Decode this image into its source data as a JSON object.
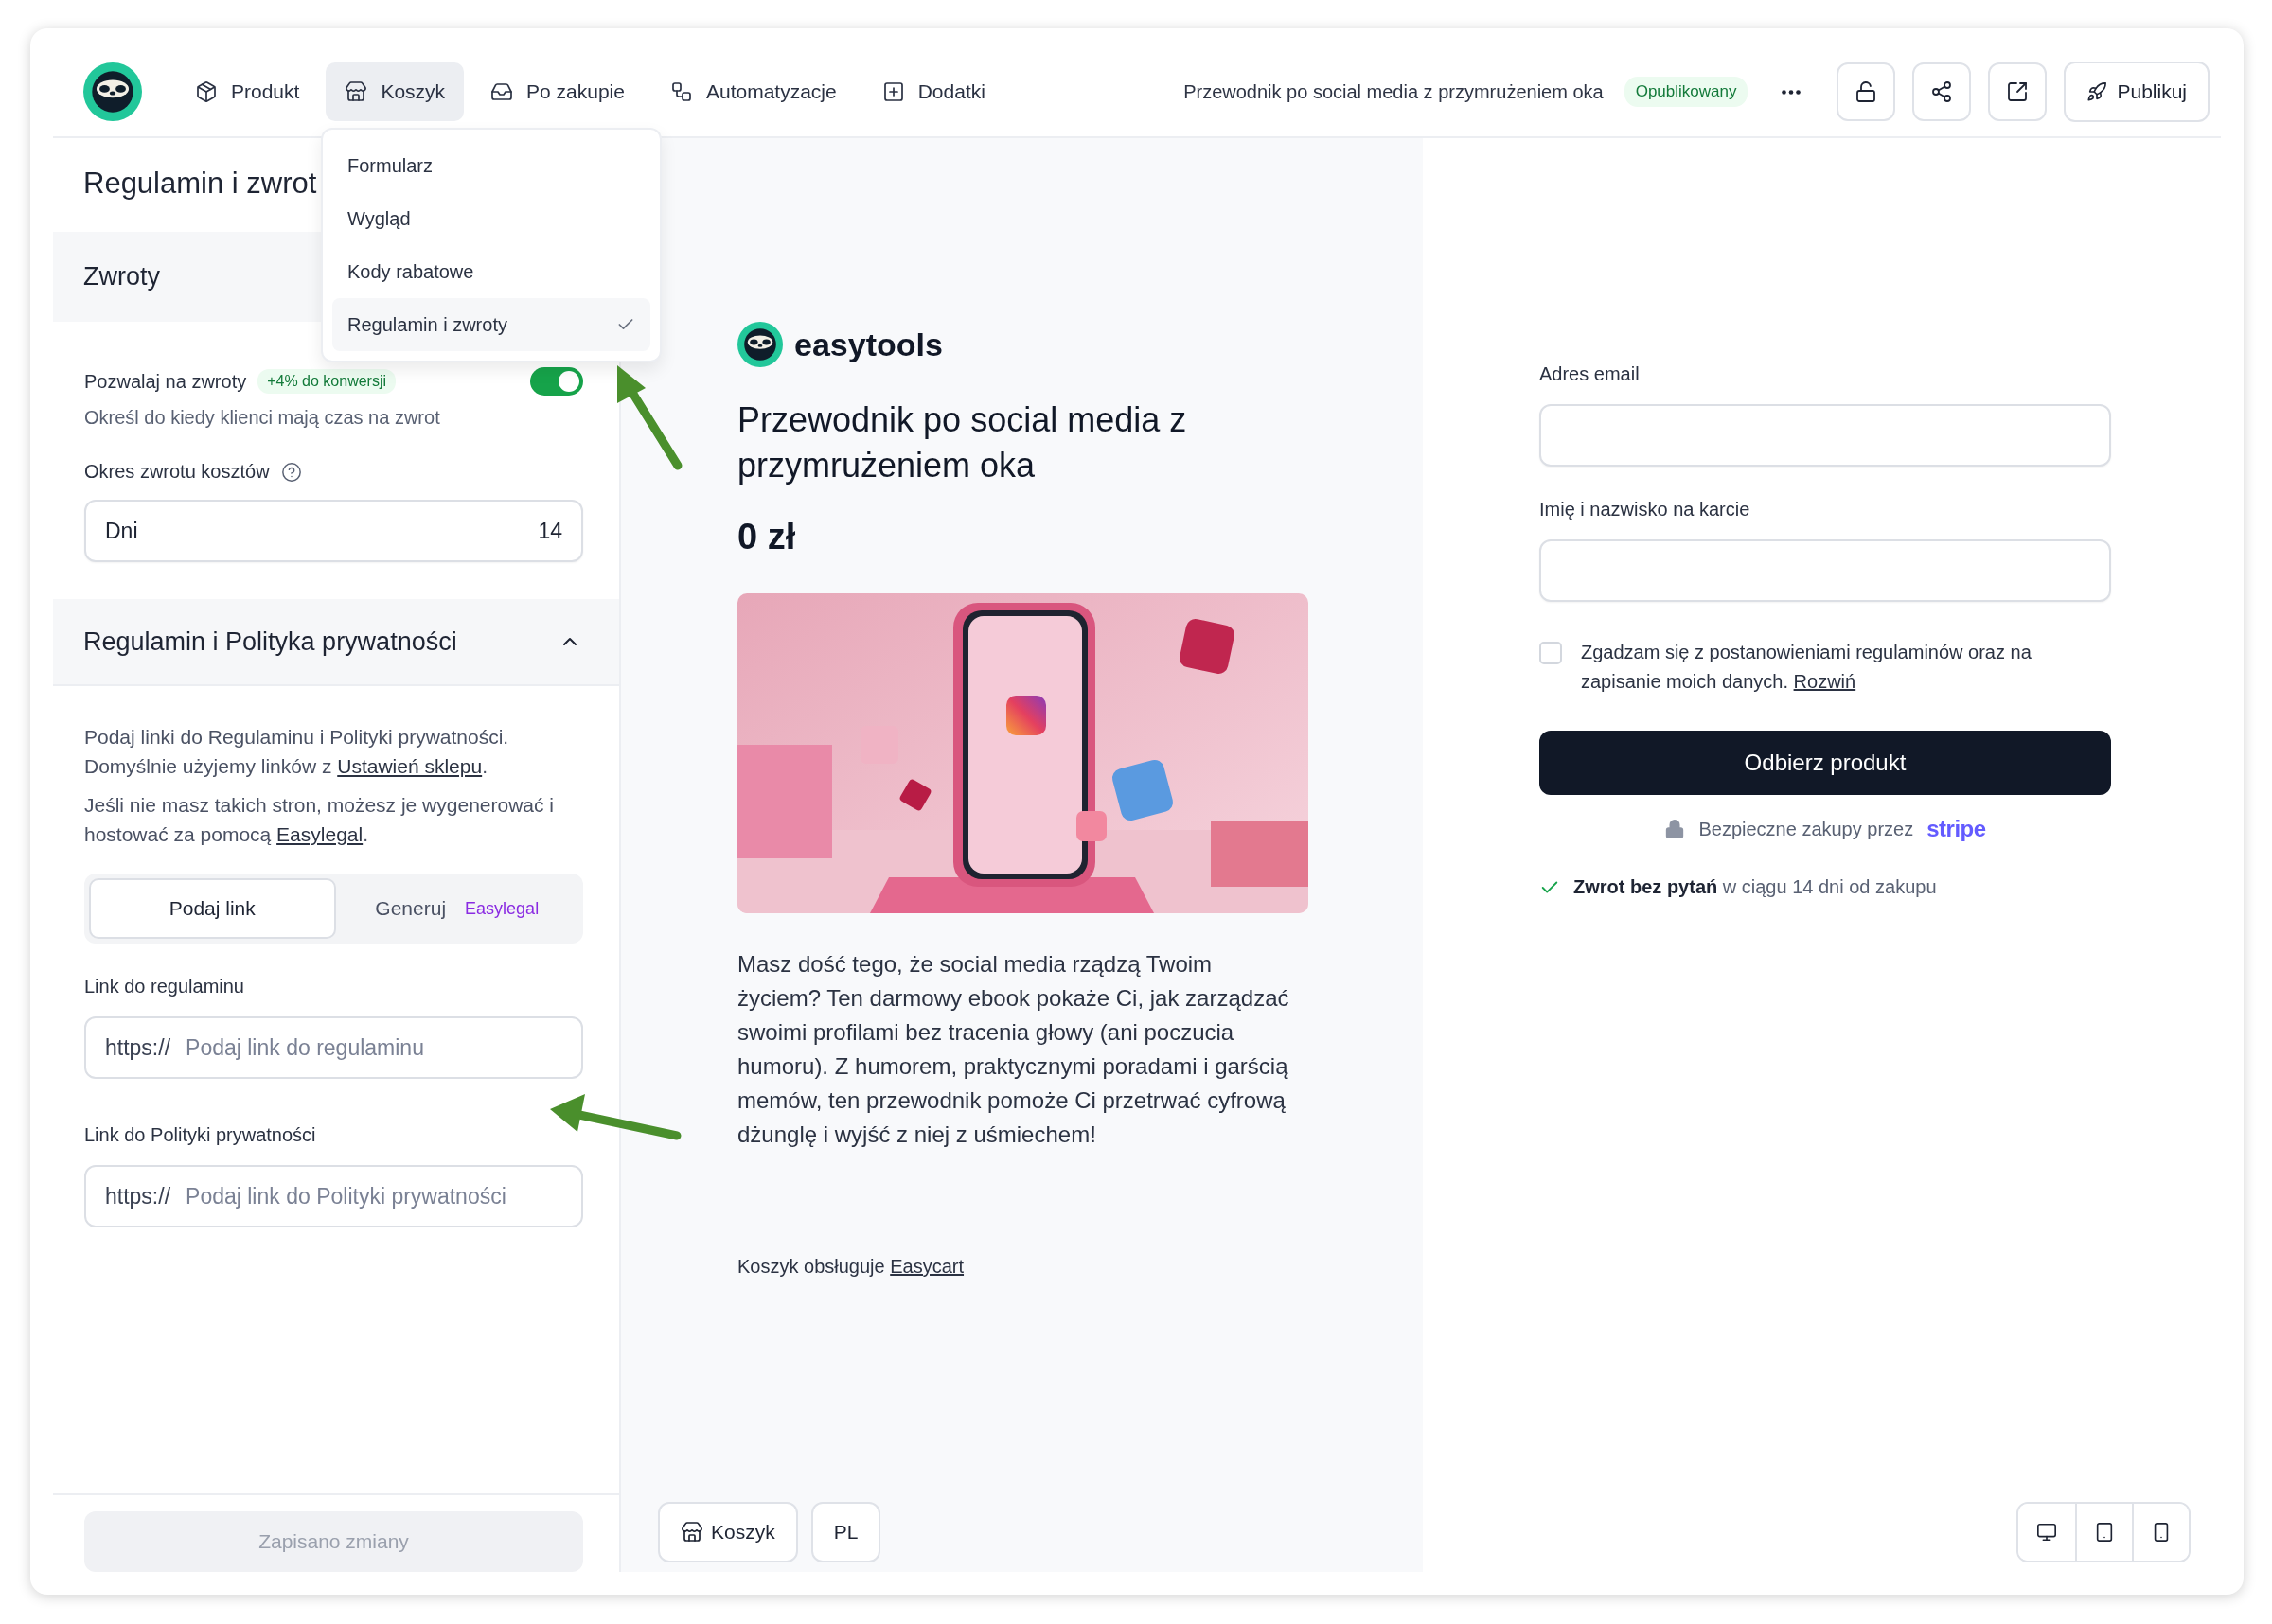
{
  "top_bar": {
    "nav": [
      {
        "label": "Produkt",
        "selected": false
      },
      {
        "label": "Koszyk",
        "selected": true
      },
      {
        "label": "Po zakupie",
        "selected": false
      },
      {
        "label": "Automatyzacje",
        "selected": false
      },
      {
        "label": "Dodatki",
        "selected": false
      }
    ],
    "product_title": "Przewodnik po social media z przymrużeniem oka",
    "status_badge": "Opublikowany",
    "publish_button": "Publikuj"
  },
  "dropdown": {
    "items": [
      {
        "label": "Formularz",
        "selected": false
      },
      {
        "label": "Wygląd",
        "selected": false
      },
      {
        "label": "Kody rabatowe",
        "selected": false
      },
      {
        "label": "Regulamin i zwroty",
        "selected": true
      }
    ]
  },
  "settings_panel": {
    "title": "Regulamin i zwrot",
    "returns_section": {
      "title": "Zwroty",
      "allow_returns": {
        "label": "Pozwalaj na zwroty",
        "badge": "+4% do konwersji",
        "on": true
      },
      "description": "Określ do kiedy klienci mają czas na zwrot",
      "period_label": "Okres zwrotu kosztów",
      "period_unit": "Dni",
      "period_value": "14"
    },
    "legal_section": {
      "title": "Regulamin i Polityka prywatności",
      "expanded": true,
      "paragraphs": [
        {
          "before": "Podaj linki do Regulaminu i Polityki prywatności. Domyślnie użyjemy linków z ",
          "link": "Ustawień sklepu",
          "after": "."
        },
        {
          "before": "Jeśli nie masz takich stron, możesz je wygenerować i hostować za pomocą ",
          "link": "Easylegal",
          "after": "."
        }
      ],
      "options": [
        {
          "label": "Podaj link",
          "selected": true
        },
        {
          "label": "Generuj",
          "badge": "Easylegal",
          "selected": false
        }
      ],
      "link_fields": [
        {
          "label": "Link do regulaminu",
          "prefix": "https://",
          "placeholder": "Podaj link do regulaminu"
        },
        {
          "label": "Link do Polityki prywatności",
          "prefix": "https://",
          "placeholder": "Podaj link do Polityki prywatności"
        }
      ]
    },
    "save_button": {
      "label": "Zapisano zmiany",
      "disabled": true
    }
  },
  "preview": {
    "brand": "easytools",
    "title": "Przewodnik po social media z przymrużeniem oka",
    "price": "0 zł",
    "description": "Masz dość tego, że social media rządzą Twoim życiem? Ten darmowy ebook pokaże Ci, jak zarządzać swoimi profilami bez tracenia głowy (ani poczucia humoru). Z humorem, praktycznymi poradami i garścią memów, ten przewodnik pomoże Ci przetrwać cyfrową dżunglę i wyjść z niej z uśmiechem!",
    "footer": {
      "text": "Koszyk obsługuje",
      "link": "Easycart"
    },
    "view_buttons": [
      {
        "label": "Koszyk"
      },
      {
        "label": "PL"
      }
    ]
  },
  "checkout": {
    "fields": [
      {
        "label": "Adres email"
      },
      {
        "label": "Imię i nazwisko na karcie"
      }
    ],
    "consent": {
      "text": "Zgadzam się z postanowieniami regulaminów oraz na zapisanie moich danych.",
      "link": "Rozwiń",
      "checked": false
    },
    "submit": "Odbierz produkt",
    "secure": {
      "text": "Bezpieczne zakupy przez",
      "brand": "stripe"
    },
    "refund": "**Zwrot bez pytań** w ciągu 14 dni od zakupu",
    "devices": [
      {
        "kind": "desktop"
      },
      {
        "kind": "tablet"
      },
      {
        "kind": "mobile"
      }
    ]
  }
}
